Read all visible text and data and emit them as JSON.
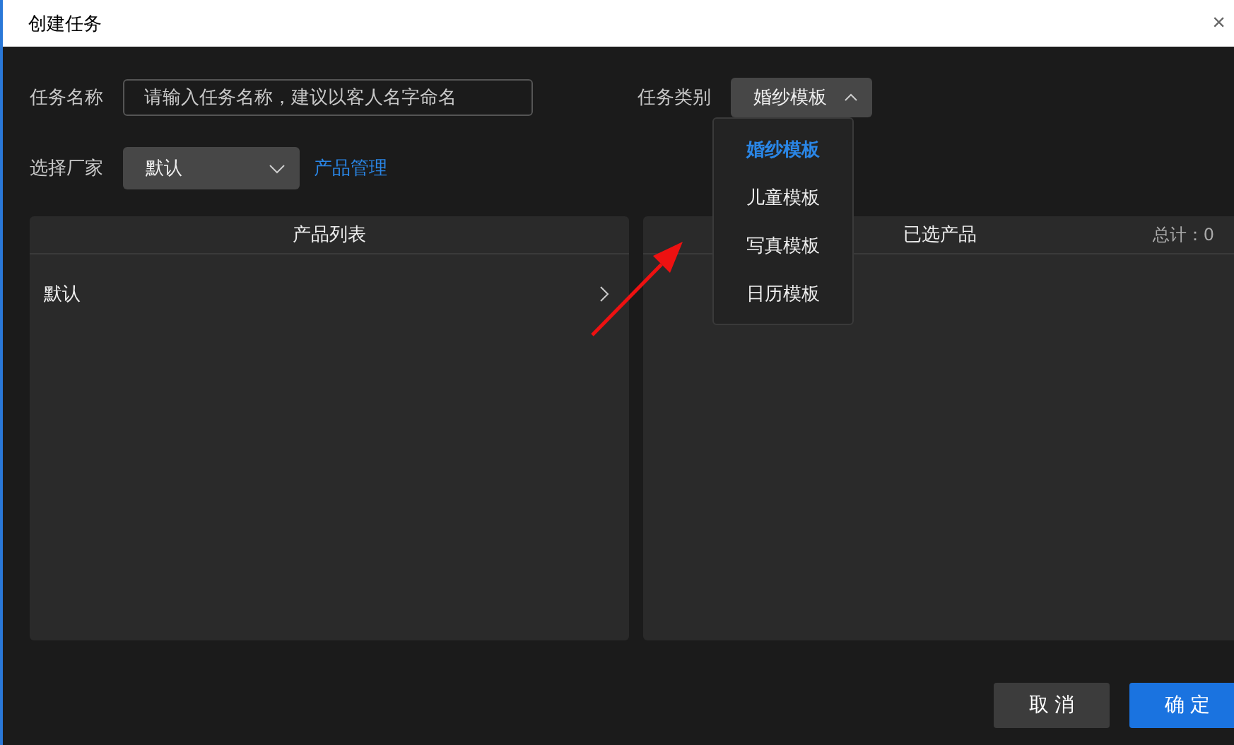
{
  "window": {
    "title": "创建任务",
    "close": "×"
  },
  "task_name": {
    "label": "任务名称",
    "placeholder": "请输入任务名称，建议以客人名字命名"
  },
  "task_type": {
    "label": "任务类别",
    "value": "婚纱模板",
    "expanded": true,
    "options": [
      {
        "label": "婚纱模板",
        "selected": true
      },
      {
        "label": "儿童模板",
        "selected": false
      },
      {
        "label": "写真模板",
        "selected": false
      },
      {
        "label": "日历模板",
        "selected": false
      }
    ]
  },
  "vendor": {
    "label": "选择厂家",
    "value": "默认",
    "link": "产品管理"
  },
  "product_list": {
    "title": "产品列表",
    "items": [
      {
        "label": "默认"
      }
    ]
  },
  "selected_products": {
    "title": "已选产品",
    "total": "总计：0"
  },
  "buttons": [
    {
      "label": "取 消",
      "kind": "secondary"
    },
    {
      "label": "确 定",
      "kind": "primary"
    }
  ]
}
